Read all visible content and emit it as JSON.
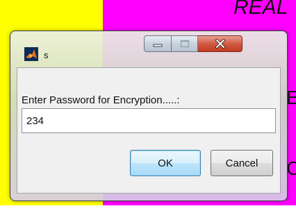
{
  "background": {
    "heading_fragment": "REAL",
    "row_fragment_1": "E",
    "row_fragment_2": "C",
    "colors": {
      "left_strip": "#ffff00",
      "right_strip": "#ff00ff"
    }
  },
  "dialog": {
    "title": "s",
    "icon": "matlab-icon",
    "window_controls": {
      "minimize": "minimize-icon",
      "maximize": "maximize-icon",
      "close": "close-icon"
    },
    "prompt": "Enter Password for Encryption.....:",
    "password_value": "234",
    "ok_label": "OK",
    "cancel_label": "Cancel"
  }
}
